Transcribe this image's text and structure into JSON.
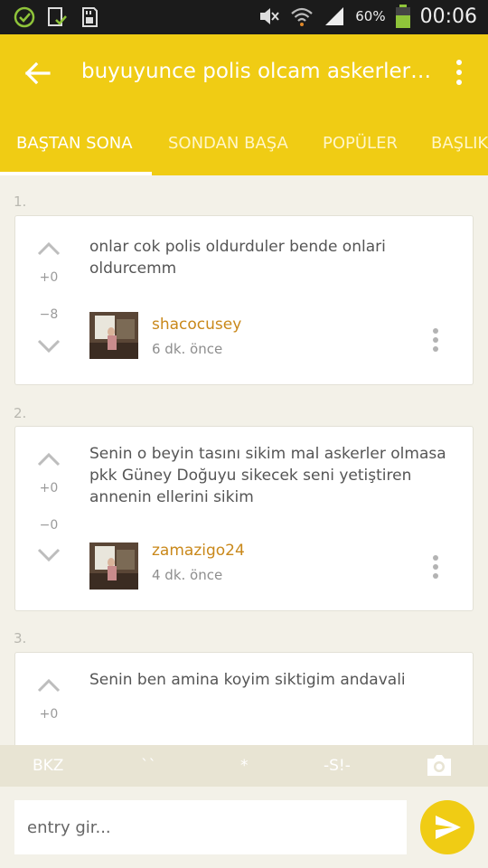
{
  "status_bar": {
    "battery": "60%",
    "time": "00:06",
    "icons": [
      "check-circle-icon",
      "download-doc-icon",
      "sd-card-icon",
      "mute-icon",
      "wifi-icon",
      "signal-icon",
      "battery-icon"
    ]
  },
  "toolbar": {
    "title": "buyuyunce polis olcam askerleri...",
    "back_icon": "arrow-back-icon",
    "menu_icon": "more-vert-icon"
  },
  "tabs": [
    "BAŞTAN SONA",
    "SONDAN BAŞA",
    "POPÜLER",
    "BAŞLIK"
  ],
  "entries": [
    {
      "index": "1.",
      "text_lines": [
        "onlar cok polis oldurduler bende onlari",
        "oldurcemm"
      ],
      "up": "+0",
      "down": "−8",
      "author": "shacocusey",
      "time": "6 dk. önce"
    },
    {
      "index": "2.",
      "text_lines": [
        "Senin o beyin tasını sikim mal askerler olmasa",
        "pkk Güney Doğuyu sikecek seni yetiştiren",
        "annenin ellerini sikim"
      ],
      "up": "+0",
      "down": "−0",
      "author": "zamazigo24",
      "time": "4 dk. önce"
    },
    {
      "index": "3.",
      "text_lines": [
        "Senin ben amina koyim siktigim andavali"
      ],
      "up": "+0"
    }
  ],
  "format_bar": [
    "BKZ",
    "``",
    "*",
    "-S!-"
  ],
  "input": {
    "placeholder": "entry gir..."
  },
  "colors": {
    "accent": "#f0cc14",
    "author": "#c9881a",
    "background": "#f3f1e8"
  }
}
